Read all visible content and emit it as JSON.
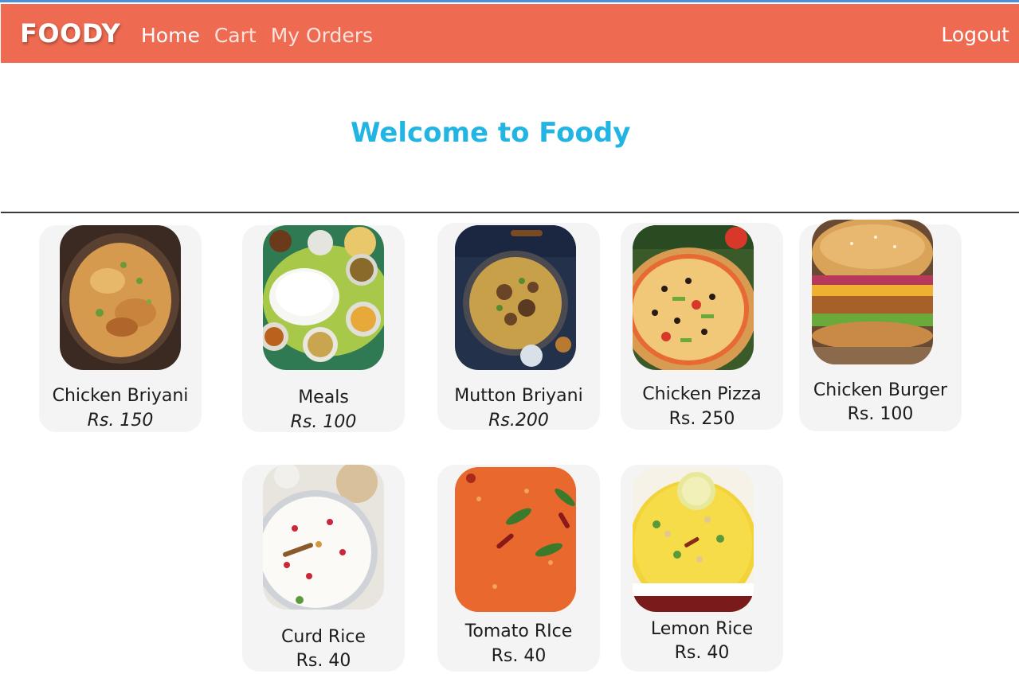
{
  "nav": {
    "brand": "FOODY",
    "home": "Home",
    "cart": "Cart",
    "orders": "My Orders",
    "logout": "Logout"
  },
  "colors": {
    "navbar": "#ee6a50",
    "heading": "#22b5e3",
    "card_background": "#f4f4f4",
    "top_accent": "#4a90d9"
  },
  "hero": {
    "title": "Welcome to Foody"
  },
  "items": [
    {
      "name": "Chicken Briyani",
      "price": "Rs. 150"
    },
    {
      "name": "Meals",
      "price": "Rs. 100"
    },
    {
      "name": "Mutton Briyani",
      "price": "Rs.200"
    },
    {
      "name": "Chicken Pizza",
      "price": "Rs. 250"
    },
    {
      "name": "Chicken Burger",
      "price": "Rs. 100"
    },
    {
      "name": "Curd Rice",
      "price": "Rs. 40"
    },
    {
      "name": "Tomato RIce",
      "price": "Rs. 40"
    },
    {
      "name": "Lemon Rice",
      "price": "Rs. 40"
    }
  ]
}
